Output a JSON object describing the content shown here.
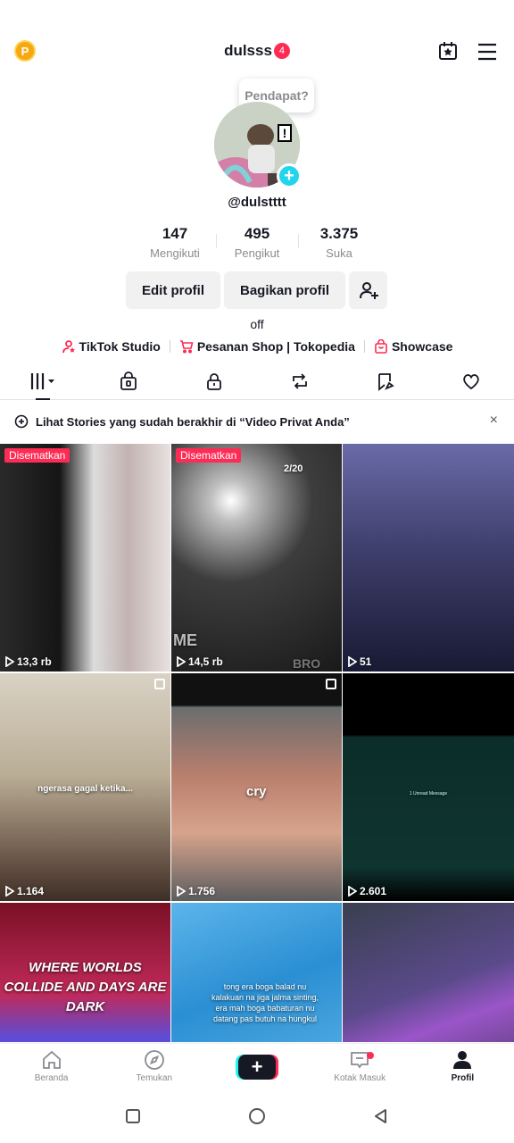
{
  "header": {
    "coin_label": "P",
    "username": "dulsss",
    "notif_count": "4",
    "icons": [
      "calendar-star-icon",
      "hamburger-menu-icon"
    ]
  },
  "profile": {
    "tooltip": "Pendapat?",
    "handle": "@dulstttt",
    "stats": [
      {
        "value": "147",
        "label": "Mengikuti"
      },
      {
        "value": "495",
        "label": "Pengikut"
      },
      {
        "value": "3.375",
        "label": "Suka"
      }
    ],
    "edit_label": "Edit profil",
    "share_label": "Bagikan profil",
    "bio": "off",
    "links": {
      "studio": "TikTok Studio",
      "shop": "Pesanan Shop | Tokopedia",
      "showcase": "Showcase"
    }
  },
  "banner": {
    "text": "Lihat Stories yang sudah berakhir di “Video Privat Anda”",
    "close": "×"
  },
  "videos": [
    {
      "views": "13,3 rb",
      "pinned": "Disematkan"
    },
    {
      "views": "14,5 rb",
      "pinned": "Disematkan",
      "overlay1": "2/20",
      "overlay2": "ME",
      "overlay3": "BRO"
    },
    {
      "views": "51"
    },
    {
      "views": "1.164",
      "caption": "ngerasa gagal ketika..."
    },
    {
      "views": "1.756",
      "caption": "cry"
    },
    {
      "views": "2.601",
      "caption": "1 Unread Message"
    },
    {
      "caption": "WHERE WORLDS COLLIDE AND DAYS ARE DARK"
    },
    {
      "caption": "tong era boga balad nu kalakuan na jiga jalma sinting, era mah boga babaturan nu datang pas butuh na hungkul"
    },
    {}
  ],
  "bottom_nav": [
    {
      "label": "Beranda"
    },
    {
      "label": "Temukan"
    },
    {
      "label": "+"
    },
    {
      "label": "Kotak Masuk"
    },
    {
      "label": "Profil"
    }
  ],
  "colors": {
    "accent": "#fe2c55",
    "cyan": "#20d5ec",
    "text": "#161823",
    "muted": "#8a8b91",
    "button_bg": "#f1f1f2"
  }
}
